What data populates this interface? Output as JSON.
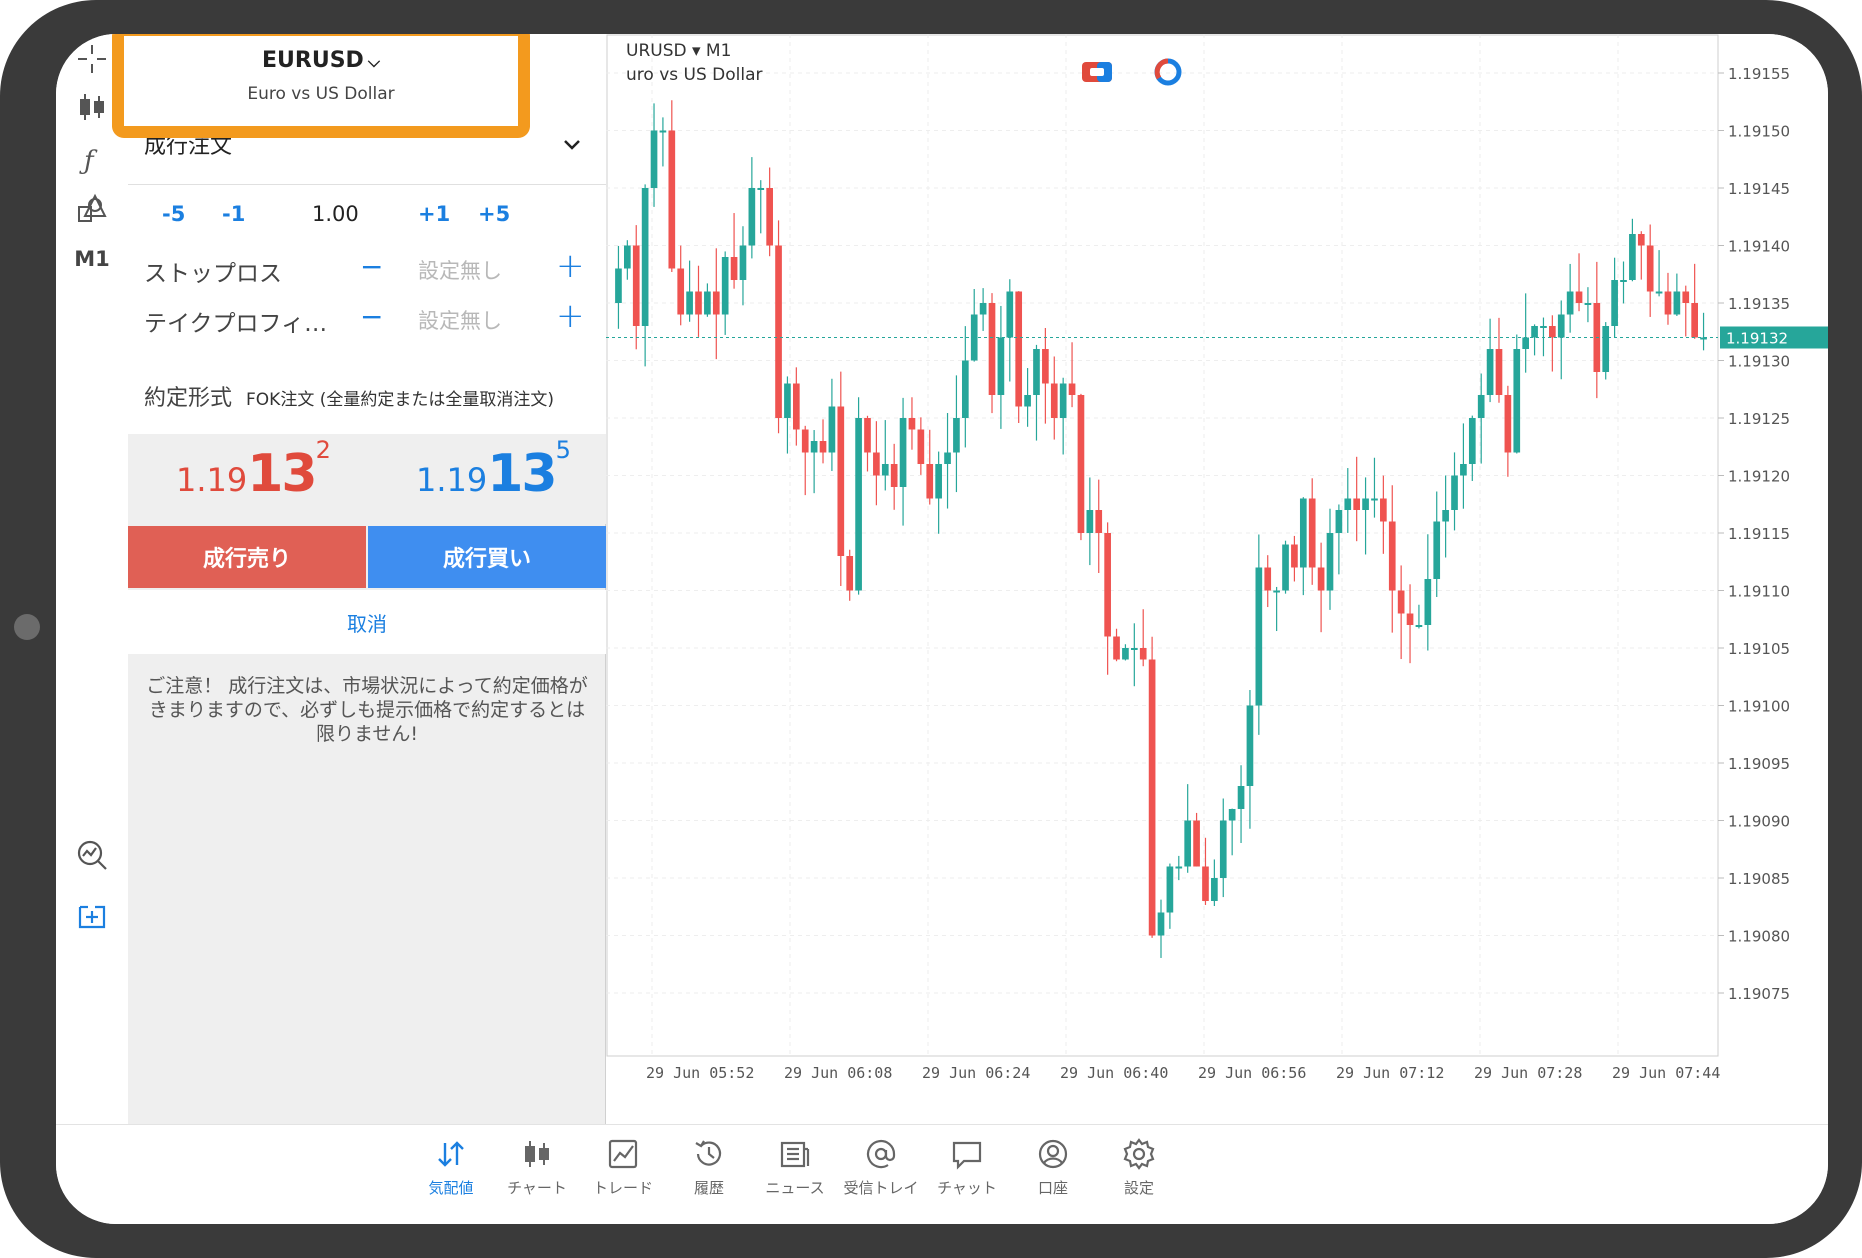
{
  "app": {
    "toolbar": {
      "timeframe": "M1",
      "icons": [
        "crosshair-icon",
        "candlestick-icon",
        "indicator-icon",
        "objects-icon",
        "market-watch-icon",
        "new-order-icon"
      ]
    },
    "symbol": {
      "name": "EURUSD",
      "description": "Euro vs US Dollar"
    },
    "order": {
      "type_label": "成行注文",
      "volume": {
        "minus5": "-5",
        "minus1": "-1",
        "value": "1.00",
        "plus1": "+1",
        "plus5": "+5"
      },
      "stop_loss": {
        "label": "ストップロス",
        "minus": "−",
        "value": "設定無し",
        "plus": "+"
      },
      "take_profit": {
        "label": "テイクプロフィ…",
        "minus": "−",
        "value": "設定無し",
        "plus": "+"
      },
      "fill_policy": {
        "label": "約定形式",
        "value": "FOK注文 (全量約定または全量取消注文)"
      },
      "bid": {
        "prefix": "1.19",
        "big": "13",
        "sup": "2"
      },
      "ask": {
        "prefix": "1.19",
        "big": "13",
        "sup": "5"
      },
      "sell_label": "成行売り",
      "buy_label": "成行買い",
      "cancel_label": "取消",
      "note": "ご注意！ 成行注文は、市場状況によって約定価格がきまりますので、必ずしも提示価格で約定するとは限りません!"
    },
    "chart_header": {
      "symbol": "URUSD",
      "arrow": "▾",
      "timeframe": "M1",
      "description": "uro vs US Dollar"
    },
    "nav": [
      {
        "label": "気配値",
        "icon": "quotes-icon",
        "active": true
      },
      {
        "label": "チャート",
        "icon": "chart-icon",
        "active": false
      },
      {
        "label": "トレード",
        "icon": "trade-icon",
        "active": false
      },
      {
        "label": "履歴",
        "icon": "history-icon",
        "active": false
      },
      {
        "label": "ニュース",
        "icon": "news-icon",
        "active": false
      },
      {
        "label": "受信トレイ",
        "icon": "mail-icon",
        "active": false
      },
      {
        "label": "チャット",
        "icon": "chat-icon",
        "active": false
      },
      {
        "label": "口座",
        "icon": "account-icon",
        "active": false
      },
      {
        "label": "設定",
        "icon": "settings-icon",
        "active": false
      }
    ]
  },
  "chart_data": {
    "type": "candlestick",
    "symbol": "EURUSD",
    "timeframe": "M1",
    "ylim": [
      1.19073,
      1.19157
    ],
    "y_ticks": [
      "1.19155",
      "1.19150",
      "1.19145",
      "1.19140",
      "1.19135",
      "1.19130",
      "1.19125",
      "1.19120",
      "1.19115",
      "1.19110",
      "1.19105",
      "1.19100",
      "1.19095",
      "1.19090",
      "1.19085",
      "1.19080",
      "1.19075"
    ],
    "x_ticks": [
      "29 Jun 05:52",
      "29 Jun 06:08",
      "29 Jun 06:24",
      "29 Jun 06:40",
      "29 Jun 06:56",
      "29 Jun 07:12",
      "29 Jun 07:28",
      "29 Jun 07:44"
    ],
    "current_price": "1.19132",
    "colors": {
      "up": "#26a69a",
      "down": "#ef5350",
      "price_line": "#26a69a",
      "price_label_bg": "#26a69a"
    },
    "closes": [
      1.19138,
      1.1914,
      1.19133,
      1.19145,
      1.1915,
      1.1915,
      1.19138,
      1.19134,
      1.19136,
      1.19134,
      1.19136,
      1.19134,
      1.19139,
      1.19137,
      1.1914,
      1.19145,
      1.19145,
      1.1914,
      1.19125,
      1.19128,
      1.19124,
      1.19122,
      1.19123,
      1.19122,
      1.19126,
      1.19113,
      1.1911,
      1.19125,
      1.19122,
      1.1912,
      1.19121,
      1.19119,
      1.19125,
      1.19124,
      1.19121,
      1.19118,
      1.19121,
      1.19122,
      1.19125,
      1.1913,
      1.19134,
      1.19135,
      1.19127,
      1.19132,
      1.19136,
      1.19126,
      1.19127,
      1.19131,
      1.19128,
      1.19125,
      1.19128,
      1.19127,
      1.19115,
      1.19117,
      1.19115,
      1.19106,
      1.19104,
      1.19105,
      1.19105,
      1.19104,
      1.1908,
      1.19082,
      1.19086,
      1.19086,
      1.1909,
      1.19086,
      1.19083,
      1.19085,
      1.1909,
      1.19091,
      1.19093,
      1.191,
      1.19112,
      1.1911,
      1.1911,
      1.19114,
      1.19112,
      1.19118,
      1.19112,
      1.1911,
      1.19115,
      1.19117,
      1.19118,
      1.19117,
      1.19118,
      1.19118,
      1.19116,
      1.1911,
      1.19108,
      1.19107,
      1.19107,
      1.19111,
      1.19116,
      1.19117,
      1.1912,
      1.19121,
      1.19125,
      1.19127,
      1.19131,
      1.19127,
      1.19122,
      1.19131,
      1.19132,
      1.19133,
      1.19133,
      1.19132,
      1.19134,
      1.19136,
      1.19135,
      1.19135,
      1.19129,
      1.19133,
      1.19137,
      1.19137,
      1.19141,
      1.1914,
      1.19136,
      1.19136,
      1.19134,
      1.19136,
      1.19135,
      1.19132,
      1.19132
    ]
  }
}
